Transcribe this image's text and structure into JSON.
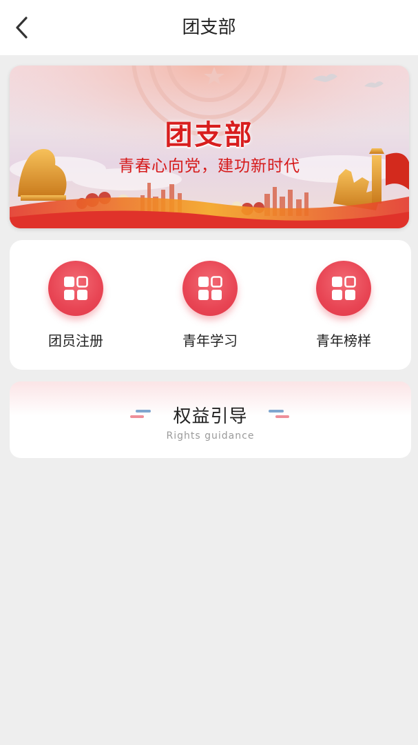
{
  "header": {
    "title": "团支部",
    "back_icon": "chevron-left-icon"
  },
  "banner": {
    "title": "团支部",
    "subtitle": "青春心向党，建功新时代"
  },
  "menu": {
    "items": [
      {
        "label": "团员注册",
        "icon": "grid-icon"
      },
      {
        "label": "青年学习",
        "icon": "grid-icon"
      },
      {
        "label": "青年榜样",
        "icon": "grid-icon"
      }
    ]
  },
  "rights": {
    "title": "权益引导",
    "subtitle": "Rights guidance"
  },
  "colors": {
    "accent": "#e84554",
    "banner_red": "#d81e1e",
    "background": "#eeeeee",
    "deco_blue": "#7fa6cf",
    "deco_pink": "#ef8f99"
  }
}
